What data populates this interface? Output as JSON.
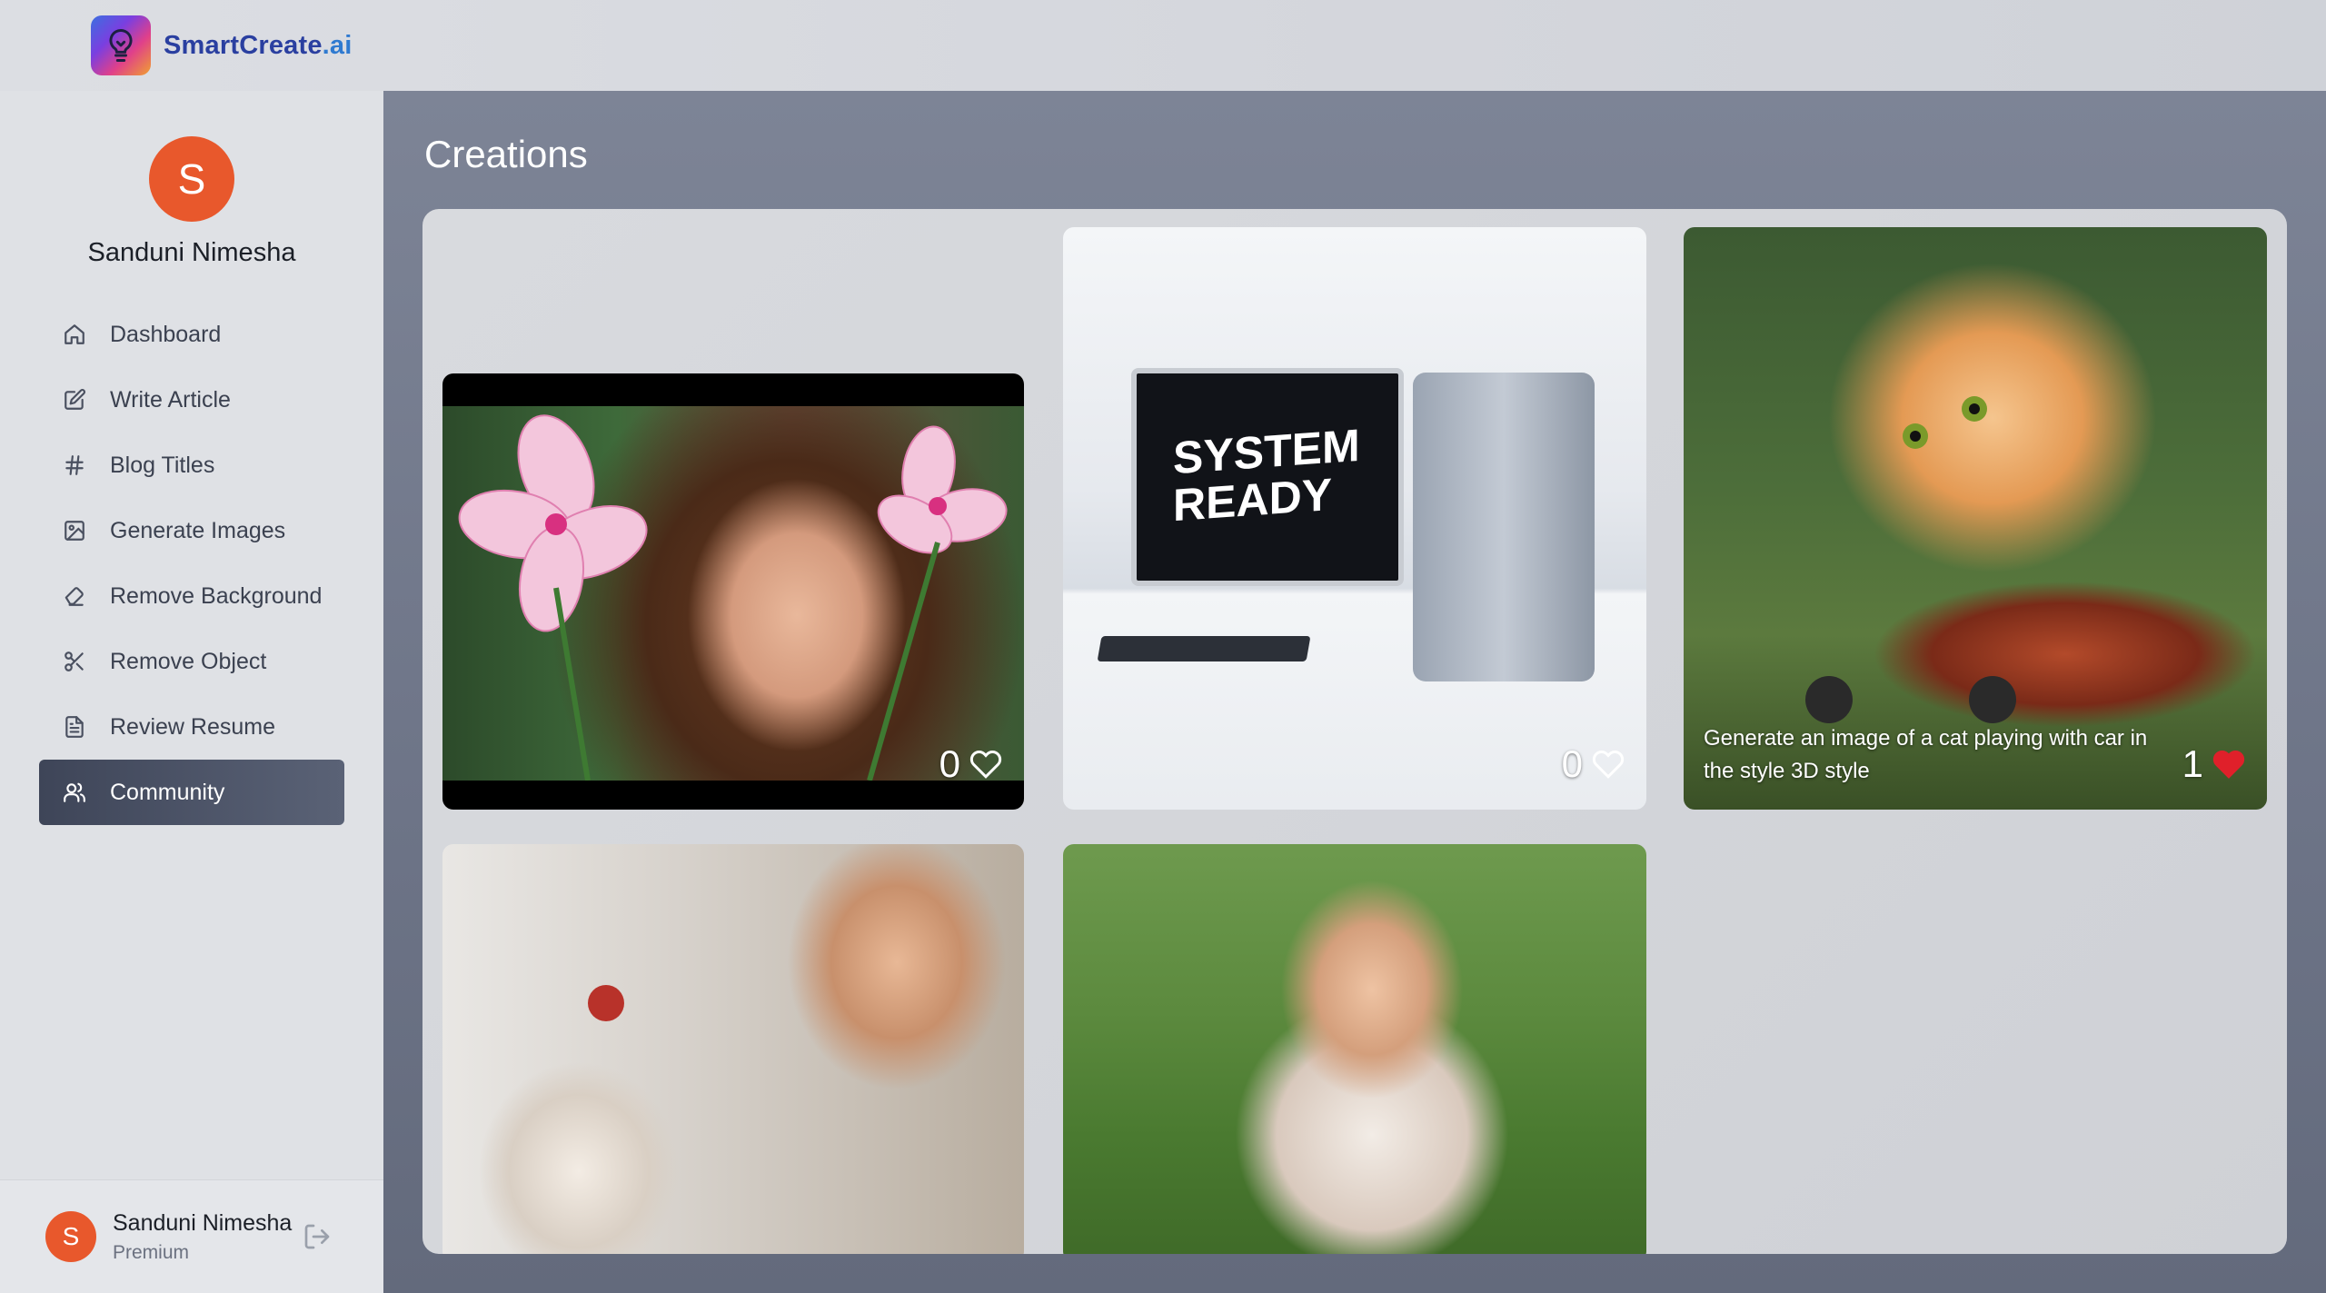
{
  "brand": {
    "name_part1": "SmartCreate",
    "name_part2": ".ai",
    "logo_icon": "lightbulb-icon"
  },
  "sidebar": {
    "profile": {
      "initial": "S",
      "name": "Sanduni Nimesha"
    },
    "items": [
      {
        "label": "Dashboard",
        "icon": "home-icon",
        "active": false
      },
      {
        "label": "Write Article",
        "icon": "edit-icon",
        "active": false
      },
      {
        "label": "Blog Titles",
        "icon": "hash-icon",
        "active": false
      },
      {
        "label": "Generate Images",
        "icon": "image-icon",
        "active": false
      },
      {
        "label": "Remove Background",
        "icon": "eraser-icon",
        "active": false
      },
      {
        "label": "Remove Object",
        "icon": "scissors-icon",
        "active": false
      },
      {
        "label": "Review Resume",
        "icon": "file-text-icon",
        "active": false
      },
      {
        "label": "Community",
        "icon": "users-icon",
        "active": true
      }
    ],
    "user": {
      "initial": "S",
      "name": "Sanduni Nimesha",
      "plan": "Premium",
      "logout_icon": "logout-icon"
    }
  },
  "main": {
    "title": "Creations",
    "creations": [
      {
        "likes": "0",
        "liked": false,
        "monitor_text": ""
      },
      {
        "likes": "0",
        "liked": false,
        "monitor_text": "SYSTEM READY"
      },
      {
        "likes": "1",
        "liked": true,
        "prompt": "Generate an image of a cat playing with car in the style 3D style"
      },
      {
        "likes": "",
        "liked": false
      },
      {
        "likes": "",
        "liked": false
      }
    ]
  },
  "colors": {
    "accent_avatar": "#e8582c",
    "active_nav": "#3e4558",
    "liked_heart": "#e0202a"
  }
}
